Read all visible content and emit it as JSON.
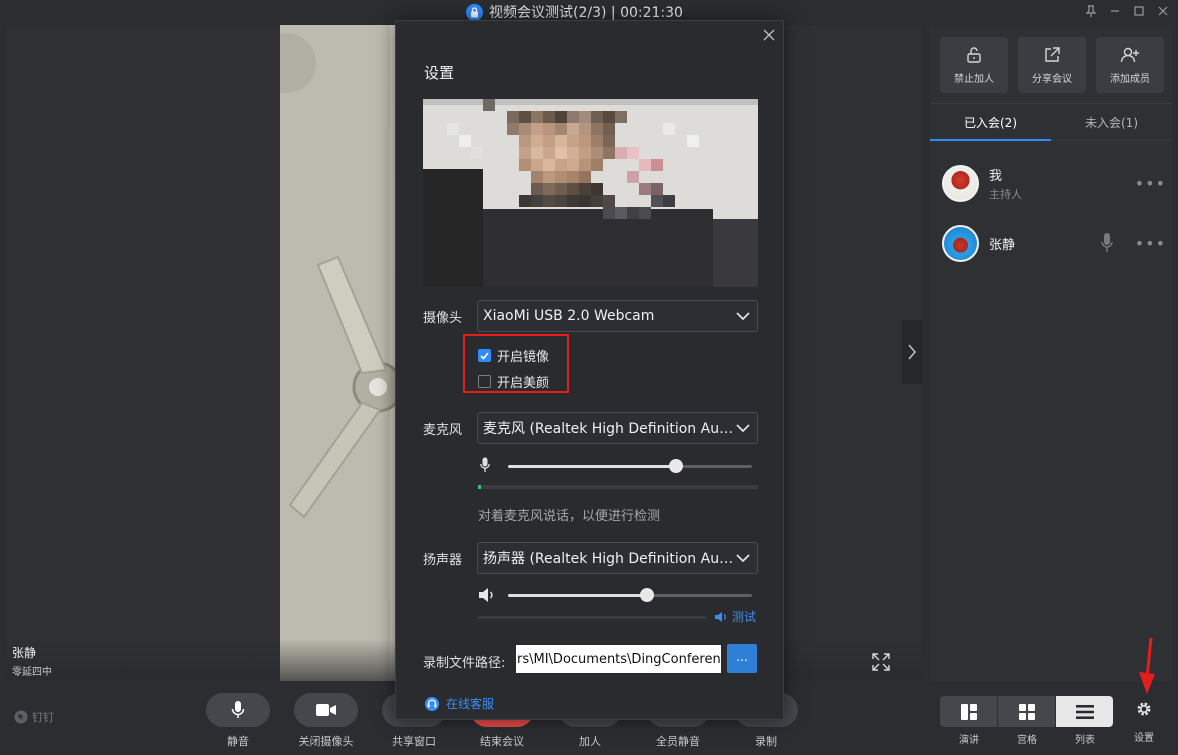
{
  "window": {
    "title": "视频会议测试(2/3) | 00:21:30",
    "controls": [
      "pin-icon",
      "minimize-icon",
      "maximize-icon",
      "close-icon"
    ]
  },
  "video": {
    "speaker_name": "张静",
    "speaker_sub": "零延四中"
  },
  "right_panel": {
    "actions": [
      {
        "label": "禁止加人",
        "icon": "unlock-icon"
      },
      {
        "label": "分享会议",
        "icon": "share-icon"
      },
      {
        "label": "添加成员",
        "icon": "add-user-icon"
      }
    ],
    "tabs": [
      {
        "label": "已入会(2)",
        "active": true
      },
      {
        "label": "未入会(1)",
        "active": false
      }
    ],
    "members": [
      {
        "name": "我",
        "role": "主持人",
        "more": "•••"
      },
      {
        "name": "张静",
        "role": "",
        "more": "•••"
      }
    ]
  },
  "toolbar": {
    "brand": "钉钉",
    "tools": [
      {
        "label": "静音",
        "icon": "mic-icon"
      },
      {
        "label": "关闭摄像头",
        "icon": "camera-icon"
      },
      {
        "label": "共享窗口",
        "icon": "share-screen-icon"
      },
      {
        "label": "结束会议",
        "icon": "end-call-icon"
      },
      {
        "label": "加人",
        "icon": "add-person-icon"
      },
      {
        "label": "全员静音",
        "icon": "mute-all-icon"
      },
      {
        "label": "录制",
        "icon": "record-icon"
      }
    ],
    "views": [
      {
        "label": "演讲",
        "icon": "speaker-view-icon"
      },
      {
        "label": "宫格",
        "icon": "grid-view-icon"
      },
      {
        "label": "列表",
        "icon": "list-view-icon",
        "active": true
      }
    ],
    "settings_label": "设置"
  },
  "dialog": {
    "title": "设置",
    "camera_label": "摄像头",
    "camera_value": "XiaoMi USB 2.0 Webcam",
    "mirror_label": "开启镜像",
    "mirror_checked": true,
    "beauty_label": "开启美颜",
    "beauty_checked": false,
    "mic_label": "麦克风",
    "mic_value": "麦克风 (Realtek High Definition Audio)",
    "mic_volume": 0.69,
    "mic_level": 0.01,
    "mic_hint": "对着麦克风说话，以便进行检测",
    "speaker_label": "扬声器",
    "speaker_value": "扬声器 (Realtek High Definition Audio)",
    "speaker_volume": 0.57,
    "test_label": "测试",
    "record_path_label": "录制文件路径:",
    "record_path_value": "rs\\MI\\Documents\\DingConference",
    "browse_label": "...",
    "support_label": "在线客服"
  },
  "colors": {
    "accent": "#2f8bff",
    "highlight": "#e41d1d",
    "background": "#2b2d31"
  }
}
